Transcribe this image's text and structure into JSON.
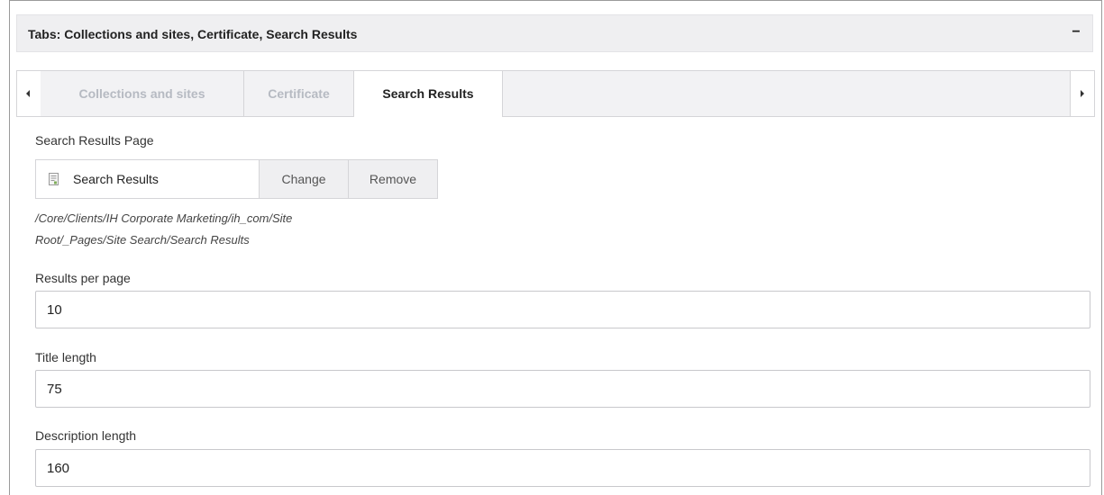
{
  "panel": {
    "title": "Tabs: Collections and sites, Certificate, Search Results",
    "collapse_label": "−"
  },
  "tabs": [
    {
      "label": "Collections and sites",
      "active": false
    },
    {
      "label": "Certificate",
      "active": false
    },
    {
      "label": "Search Results",
      "active": true
    }
  ],
  "search_results_page": {
    "label": "Search Results Page",
    "page_name": "Search Results",
    "change_label": "Change",
    "remove_label": "Remove",
    "path_line1": "/Core/Clients/IH Corporate Marketing/ih_com/Site",
    "path_line2": "Root/_Pages/Site Search/Search Results"
  },
  "results_per_page": {
    "label": "Results per page",
    "value": "10"
  },
  "title_length": {
    "label": "Title length",
    "value": "75"
  },
  "description_length": {
    "label": "Description length",
    "value": "160"
  },
  "icons": {
    "tab_prev": "caret-left-icon",
    "tab_next": "caret-right-icon",
    "page": "document-page-icon"
  }
}
